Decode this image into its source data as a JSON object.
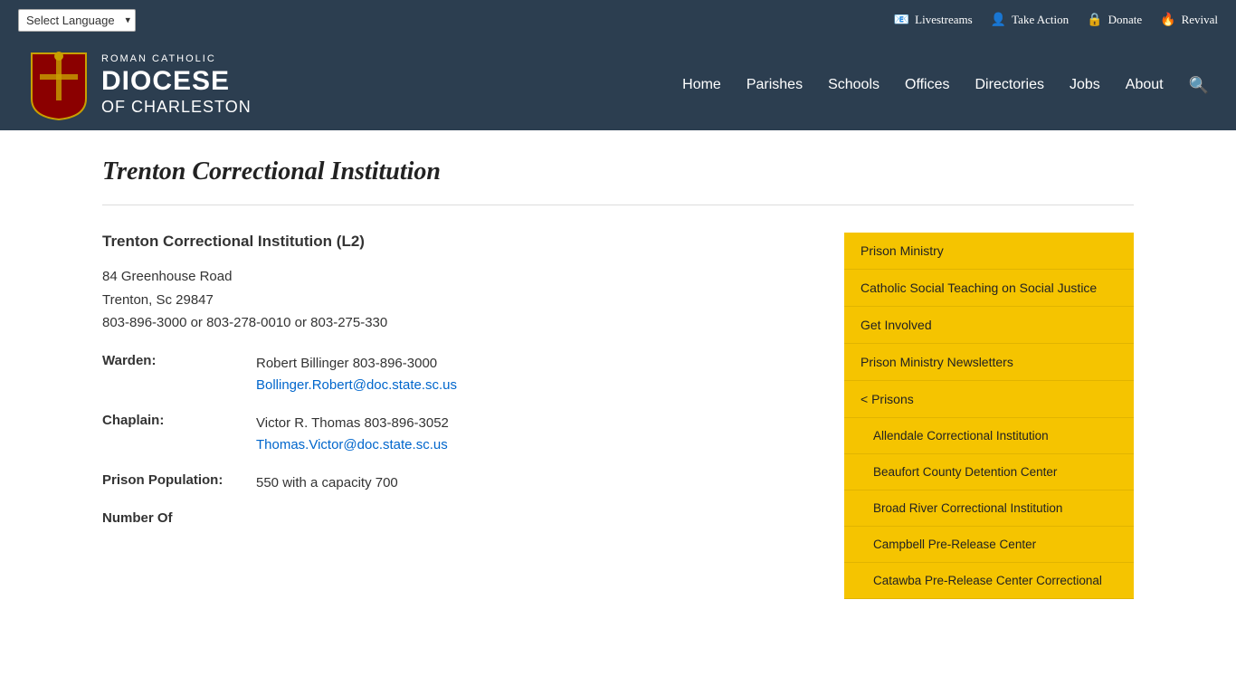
{
  "topbar": {
    "lang_label": "Select Language",
    "links": [
      {
        "id": "livestreams",
        "icon": "📧",
        "label": "Livestreams"
      },
      {
        "id": "take-action",
        "icon": "👤",
        "label": "Take Action"
      },
      {
        "id": "donate",
        "icon": "🔒",
        "label": "Donate"
      },
      {
        "id": "revival",
        "icon": "🔥",
        "label": "Revival"
      }
    ]
  },
  "logo": {
    "roman_catholic": "ROMAN CATHOLIC",
    "diocese": "DIOCESE",
    "of_charleston": "OF CHARLESTON"
  },
  "nav": {
    "items": [
      {
        "id": "home",
        "label": "Home"
      },
      {
        "id": "parishes",
        "label": "Parishes"
      },
      {
        "id": "schools",
        "label": "Schools"
      },
      {
        "id": "offices",
        "label": "Offices"
      },
      {
        "id": "directories",
        "label": "Directories"
      },
      {
        "id": "jobs",
        "label": "Jobs"
      },
      {
        "id": "about",
        "label": "About"
      }
    ]
  },
  "page": {
    "title": "Trenton Correctional Institution",
    "institution_name": "Trenton Correctional Institution (L2)",
    "address_line1": "84 Greenhouse Road",
    "address_line2": "Trenton, Sc 29847",
    "phones": "803-896-3000 or 803-278-0010 or 803-275-330",
    "warden_label": "Warden:",
    "warden_name": "Robert Billinger 803-896-3000",
    "warden_email": "Bollinger.Robert@doc.state.sc.us",
    "chaplain_label": "Chaplain:",
    "chaplain_name": "Victor R. Thomas 803-896-3052",
    "chaplain_email": "Thomas.Victor@doc.state.sc.us",
    "population_label": "Prison Population:",
    "population_value": "550 with a capacity 700",
    "number_of_label": "Number Of"
  },
  "sidebar": {
    "items": [
      {
        "id": "prison-ministry",
        "label": "Prison Ministry",
        "type": "top"
      },
      {
        "id": "catholic-social",
        "label": "Catholic Social Teaching on Social Justice",
        "type": "top"
      },
      {
        "id": "get-involved",
        "label": "Get Involved",
        "type": "top"
      },
      {
        "id": "newsletters",
        "label": "Prison Ministry Newsletters",
        "type": "top"
      },
      {
        "id": "prisons",
        "label": "< Prisons",
        "type": "parent"
      },
      {
        "id": "allendale",
        "label": "Allendale Correctional Institution",
        "type": "sub"
      },
      {
        "id": "beaufort",
        "label": "Beaufort County Detention Center",
        "type": "sub"
      },
      {
        "id": "broad-river",
        "label": "Broad River Correctional Institution",
        "type": "sub"
      },
      {
        "id": "campbell",
        "label": "Campbell Pre-Release Center",
        "type": "sub"
      },
      {
        "id": "catawba",
        "label": "Catawba Pre-Release Center Correctional",
        "type": "sub"
      }
    ]
  }
}
